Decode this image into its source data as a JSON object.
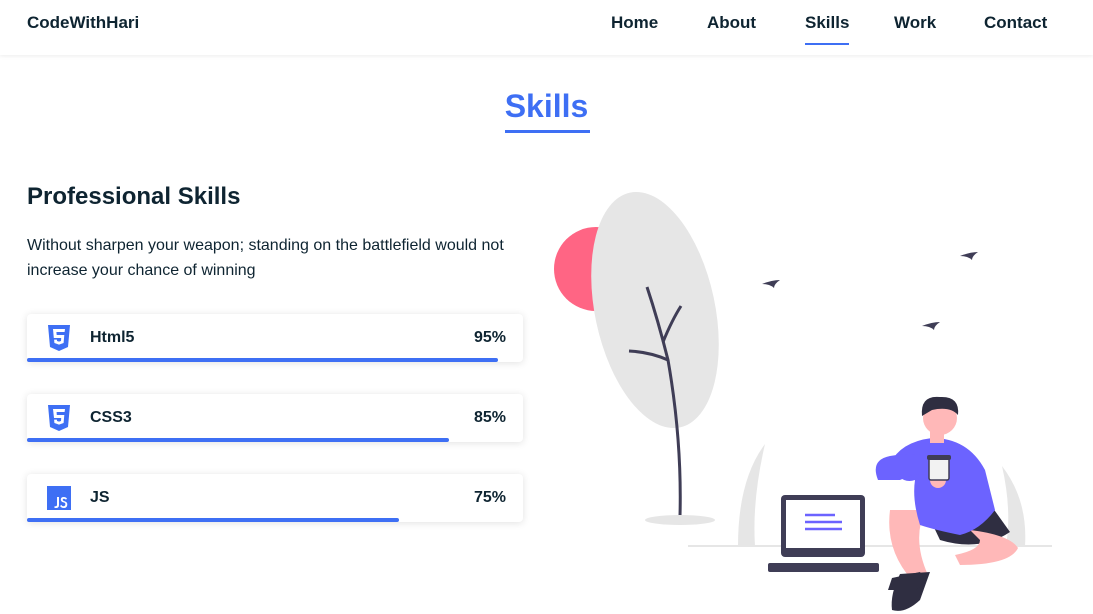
{
  "header": {
    "logo": "CodeWithHari",
    "nav": [
      {
        "label": "Home",
        "active": false
      },
      {
        "label": "About",
        "active": false
      },
      {
        "label": "Skills",
        "active": true
      },
      {
        "label": "Work",
        "active": false
      },
      {
        "label": "Contact",
        "active": false
      }
    ]
  },
  "section": {
    "title": "Skills"
  },
  "professional": {
    "title": "Professional Skills",
    "description": "Without sharpen your weapon; standing on the battlefield would not increase your chance of winning"
  },
  "skills": [
    {
      "name": "Html5",
      "percent_label": "95%",
      "level": 0.95,
      "icon": "html5-icon"
    },
    {
      "name": "CSS3",
      "percent_label": "85%",
      "level": 0.85,
      "icon": "css3-icon"
    },
    {
      "name": "JS",
      "percent_label": "75%",
      "level": 0.75,
      "icon": "js-icon"
    }
  ],
  "colors": {
    "accent": "#3e6ff4",
    "text": "#0e2431",
    "sun": "#ff6584",
    "shirt": "#6c63ff",
    "skin": "#ffb8b8"
  }
}
